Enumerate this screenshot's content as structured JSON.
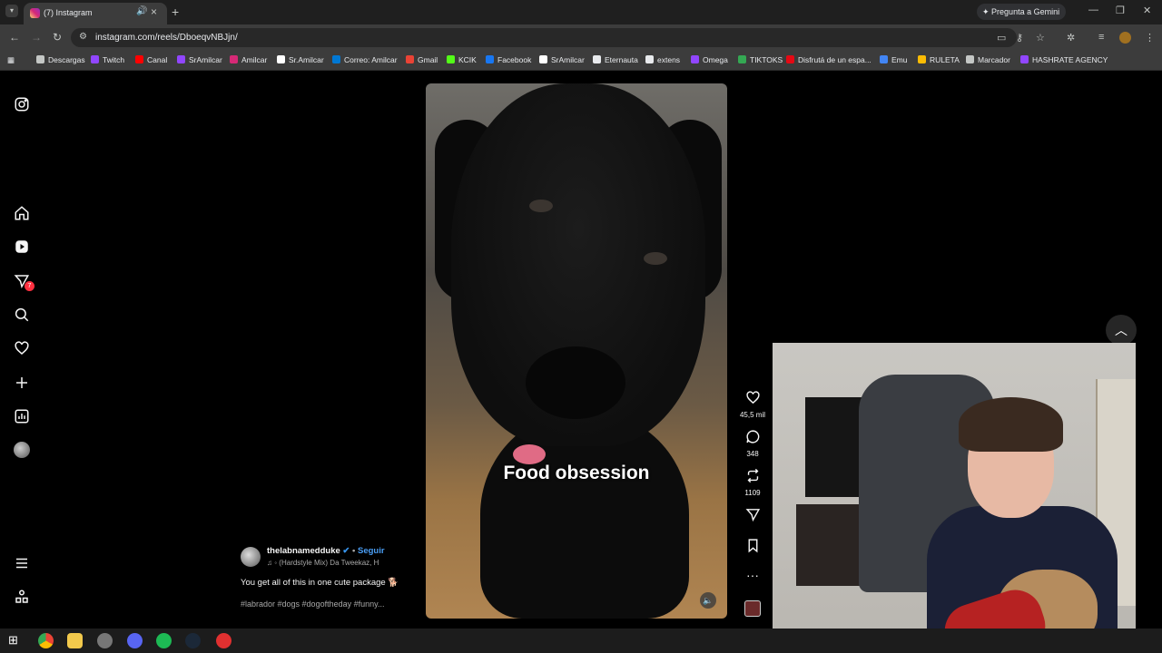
{
  "browser": {
    "tab_title": "(7) Instagram",
    "url": "instagram.com/reels/DboeqvNBJjn/",
    "gemini_label": "Pregunta a Gemini"
  },
  "bookmarks": [
    {
      "label": "Descargas",
      "color": "#c4c7c5"
    },
    {
      "label": "Twitch",
      "color": "#9146ff"
    },
    {
      "label": "Canal",
      "color": "#ff0000"
    },
    {
      "label": "SrAmilcar",
      "color": "#9146ff"
    },
    {
      "label": "Amilcar",
      "color": "#d62976"
    },
    {
      "label": "Sr.Amilcar",
      "color": "#ffffff"
    },
    {
      "label": "Correo: Amilcar",
      "color": "#0078d4"
    },
    {
      "label": "Gmail",
      "color": "#ea4335"
    },
    {
      "label": "KCIK",
      "color": "#53fc18"
    },
    {
      "label": "Facebook",
      "color": "#1877f2"
    },
    {
      "label": "SrAmilcar",
      "color": "#ffffff"
    },
    {
      "label": "Eternauta",
      "color": "#e8eaed"
    },
    {
      "label": "extens",
      "color": "#e8eaed"
    },
    {
      "label": "Omega",
      "color": "#9146ff"
    },
    {
      "label": "TIKTOKS",
      "color": "#34a853"
    },
    {
      "label": "Disfrutá de un espa...",
      "color": "#e50914"
    },
    {
      "label": "Emu",
      "color": "#4285f4"
    },
    {
      "label": "RULETA",
      "color": "#fbbc04"
    },
    {
      "label": "Marcador",
      "color": "#c4c7c5"
    },
    {
      "label": "HASHRATE AGENCY",
      "color": "#9146ff"
    }
  ],
  "sidebar": {
    "notification_count": "7",
    "icons": [
      "instagram-logo-icon",
      "home-icon",
      "reels-icon",
      "messages-icon",
      "search-icon",
      "heart-icon",
      "create-icon",
      "dashboard-icon",
      "profile-avatar",
      "menu-icon",
      "more-icon"
    ]
  },
  "reel": {
    "caption_overlay": "Food obsession",
    "author": "thelabnamedduke",
    "follow_label": "Seguir",
    "music": "(Hardstyle Mix)  Da Tweekaz, H",
    "description": "You get all of this in one cute package 🐕",
    "hashtags": "#labrador #dogs #dogoftheday #funny..."
  },
  "actions": {
    "likes": "45,5 mil",
    "comments": "348",
    "reposts": "1109"
  },
  "colors": {
    "accent_blue": "#4a9ef5",
    "badge_red": "#ff3040"
  }
}
